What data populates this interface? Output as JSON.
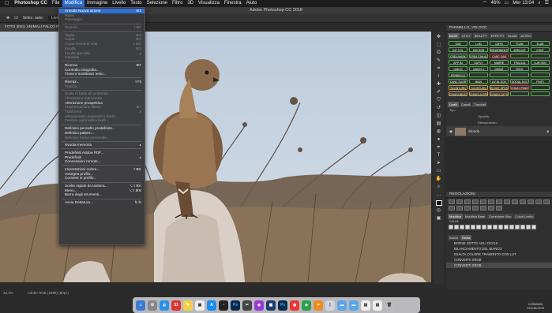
{
  "menubar": {
    "app_name": "Photoshop CC",
    "items": [
      "File",
      "Modifica",
      "Immagine",
      "Livello",
      "Testo",
      "Selezione",
      "Filtro",
      "3D",
      "Visualizza",
      "Finestra",
      "Aiuto"
    ],
    "active_index": 1,
    "status": {
      "battery": "46%",
      "clock": "Mer 13:04"
    }
  },
  "window": {
    "title": "Adobe Photoshop CC 2018"
  },
  "options_bar": {
    "select_label": "Selez. auto:",
    "select_value": "Livello"
  },
  "document": {
    "tab_title": "FOTO 2023, ANIMALI FALCO POIANA",
    "zoom": "33,3%",
    "doc_info": "Adobe RGB (1998) (8bpc)"
  },
  "edit_menu": {
    "groups": [
      [
        {
          "label": "Annulla Nuova azione",
          "shortcut": "⌘Z",
          "state": "hl"
        },
        {
          "label": "Ripeti",
          "shortcut": "",
          "state": "dis"
        },
        {
          "label": "Passaggio",
          "shortcut": "",
          "state": "dis"
        }
      ],
      [
        {
          "label": "Dissolvi...",
          "shortcut": "⇧⌘F",
          "state": "dis"
        }
      ],
      [
        {
          "label": "Taglia",
          "shortcut": "⌘X",
          "state": "dis"
        },
        {
          "label": "Copia",
          "shortcut": "⌘C",
          "state": "dis"
        },
        {
          "label": "Copia elementi uniti",
          "shortcut": "⇧⌘C",
          "state": "dis"
        },
        {
          "label": "Incolla",
          "shortcut": "⌘V",
          "state": "dis"
        },
        {
          "label": "Incolla speciale",
          "shortcut": "▸",
          "state": "dis"
        },
        {
          "label": "Cancella",
          "shortcut": "",
          "state": "dis"
        }
      ],
      [
        {
          "label": "Ricerca",
          "shortcut": "⌘F",
          "state": ""
        },
        {
          "label": "Controllo ortografia...",
          "shortcut": "",
          "state": ""
        },
        {
          "label": "Trova e sostituisci testo...",
          "shortcut": "",
          "state": ""
        }
      ],
      [
        {
          "label": "Riempi...",
          "shortcut": "⇧F5",
          "state": ""
        },
        {
          "label": "Traccia...",
          "shortcut": "",
          "state": "dis"
        }
      ],
      [
        {
          "label": "Scala in base al contenuto",
          "shortcut": "",
          "state": "dis"
        },
        {
          "label": "Alterazione marionetta",
          "shortcut": "",
          "state": "dis"
        },
        {
          "label": "Alterazione prospettica",
          "shortcut": "",
          "state": ""
        },
        {
          "label": "Trasformazione libera",
          "shortcut": "⌘T",
          "state": "dis"
        },
        {
          "label": "Trasforma",
          "shortcut": "▸",
          "state": "dis"
        },
        {
          "label": "Allineamento automatico livelli...",
          "shortcut": "",
          "state": "dis"
        },
        {
          "label": "Fusione automatica livelli...",
          "shortcut": "",
          "state": "dis"
        }
      ],
      [
        {
          "label": "Definisci pennello predefinito...",
          "shortcut": "",
          "state": ""
        },
        {
          "label": "Definisci pattern...",
          "shortcut": "",
          "state": ""
        },
        {
          "label": "Definisci forma personale...",
          "shortcut": "",
          "state": "dis"
        }
      ],
      [
        {
          "label": "Svuota memoria",
          "shortcut": "▸",
          "state": ""
        }
      ],
      [
        {
          "label": "Predefiniti Adobe PDF...",
          "shortcut": "",
          "state": ""
        },
        {
          "label": "Predefiniti",
          "shortcut": "▸",
          "state": ""
        },
        {
          "label": "Connessioni remote...",
          "shortcut": "",
          "state": ""
        }
      ],
      [
        {
          "label": "Impostazioni colore...",
          "shortcut": "⇧⌘K",
          "state": ""
        },
        {
          "label": "Assegna profilo...",
          "shortcut": "",
          "state": ""
        },
        {
          "label": "Converti in profilo...",
          "shortcut": "",
          "state": ""
        }
      ],
      [
        {
          "label": "Scelte rapide da tastiera...",
          "shortcut": "⌥⇧⌘K",
          "state": ""
        },
        {
          "label": "Menu...",
          "shortcut": "⌥⇧⌘M",
          "state": ""
        },
        {
          "label": "Barra degli strumenti...",
          "shortcut": "",
          "state": ""
        }
      ],
      [
        {
          "label": "Avvia Dettatura...",
          "shortcut": "fn fn",
          "state": ""
        }
      ]
    ]
  },
  "panel_veloci": {
    "title": "PANNELLO_VELOCE",
    "tabs": [
      "BASE",
      "UTILY",
      "BEAUTY",
      "EFFETTI",
      "GLAM",
      "ALTRO"
    ],
    "buttons": [
      {
        "t": "SUB",
        "c": "g"
      },
      {
        "t": "LUM",
        "c": "g"
      },
      {
        "t": "CMYK",
        "c": "g"
      },
      {
        "t": "FLAM",
        "c": "g"
      },
      {
        "t": "ELAB",
        "c": "g"
      },
      {
        "t": "INT COL",
        "c": "g"
      },
      {
        "t": "MIX RGB",
        "c": "g"
      },
      {
        "t": "RIEMPIMENTO",
        "c": "g"
      },
      {
        "t": "AREA INT",
        "c": "g"
      },
      {
        "t": "CONT",
        "c": "g"
      },
      {
        "t": "CREA MASK",
        "c": "g"
      },
      {
        "t": "CREA CAN ALT",
        "c": "g"
      },
      {
        "t": "CANC CAN",
        "c": "r"
      },
      {
        "t": "",
        "c": "g"
      },
      {
        "t": "",
        "c": "g"
      },
      {
        "t": "APP IM",
        "c": "g"
      },
      {
        "t": "DUPLY",
        "c": "g"
      },
      {
        "t": "MARRE",
        "c": "g"
      },
      {
        "t": "TRACCIA",
        "c": "g"
      },
      {
        "t": "LUM SEN",
        "c": "g"
      },
      {
        "t": "UNICO",
        "c": "g"
      },
      {
        "t": "UNICO 2",
        "c": "g"
      },
      {
        "t": "DESAT",
        "c": "g"
      },
      {
        "t": "PROT",
        "c": "g"
      },
      {
        "t": "",
        "c": "g"
      },
      {
        "t": "PENNELLO",
        "c": "g"
      },
      {
        "t": "",
        "c": "g"
      },
      {
        "t": "",
        "c": "g"
      },
      {
        "t": "",
        "c": "g"
      },
      {
        "t": "",
        "c": "g"
      },
      {
        "t": "CANC SUOR",
        "c": "g"
      },
      {
        "t": "BIAN",
        "c": "g"
      },
      {
        "t": "LIV BL DOC",
        "c": "g"
      },
      {
        "t": "SOCIAL DOC",
        "c": "g"
      },
      {
        "t": "FINITI",
        "c": "g"
      },
      {
        "t": "SCONTURN",
        "c": "yel"
      },
      {
        "t": "SCONTURN",
        "c": "yel"
      },
      {
        "t": "SCONT SPESS",
        "c": "yel"
      },
      {
        "t": "CHIUDI PANNELLI",
        "c": "red"
      },
      {
        "t": "",
        "c": "g"
      },
      {
        "t": "CHIUDI BELEZ",
        "c": "yel"
      },
      {
        "t": "CHIUDI ALTRI",
        "c": "yel"
      },
      {
        "t": "CHIUDI TUTTI",
        "c": "yel"
      },
      {
        "t": "",
        "c": "g"
      },
      {
        "t": "",
        "c": "g"
      }
    ]
  },
  "layers_panel": {
    "tabs": [
      "Livelli",
      "Canali",
      "Tracciati"
    ],
    "layer_name": "Sfondo",
    "kind_label": "Tipo",
    "opacity_label": "Opacità:",
    "fill_label": "Riempimento:"
  },
  "regolazioni": {
    "title": "REGOLAZIONI",
    "tabs": [
      "Modifica",
      "Modifica Base",
      "Correzione Viso",
      "Colori Livello"
    ],
    "sub_label": "SALVA"
  },
  "history_panel": {
    "tabs": [
      "Azioni",
      "Storia"
    ],
    "items": [
      "BORSE SOTTO AGLI OCCHI",
      "BILANCIAMENTO DEL BIANCO",
      "ESALTA COLORE TRAMONTO CON LUT",
      "CONVERTI SRGB",
      "CONVERTI SRGB"
    ]
  },
  "dock": {
    "badge": "COMANDI VOCALI/Ctrl"
  }
}
